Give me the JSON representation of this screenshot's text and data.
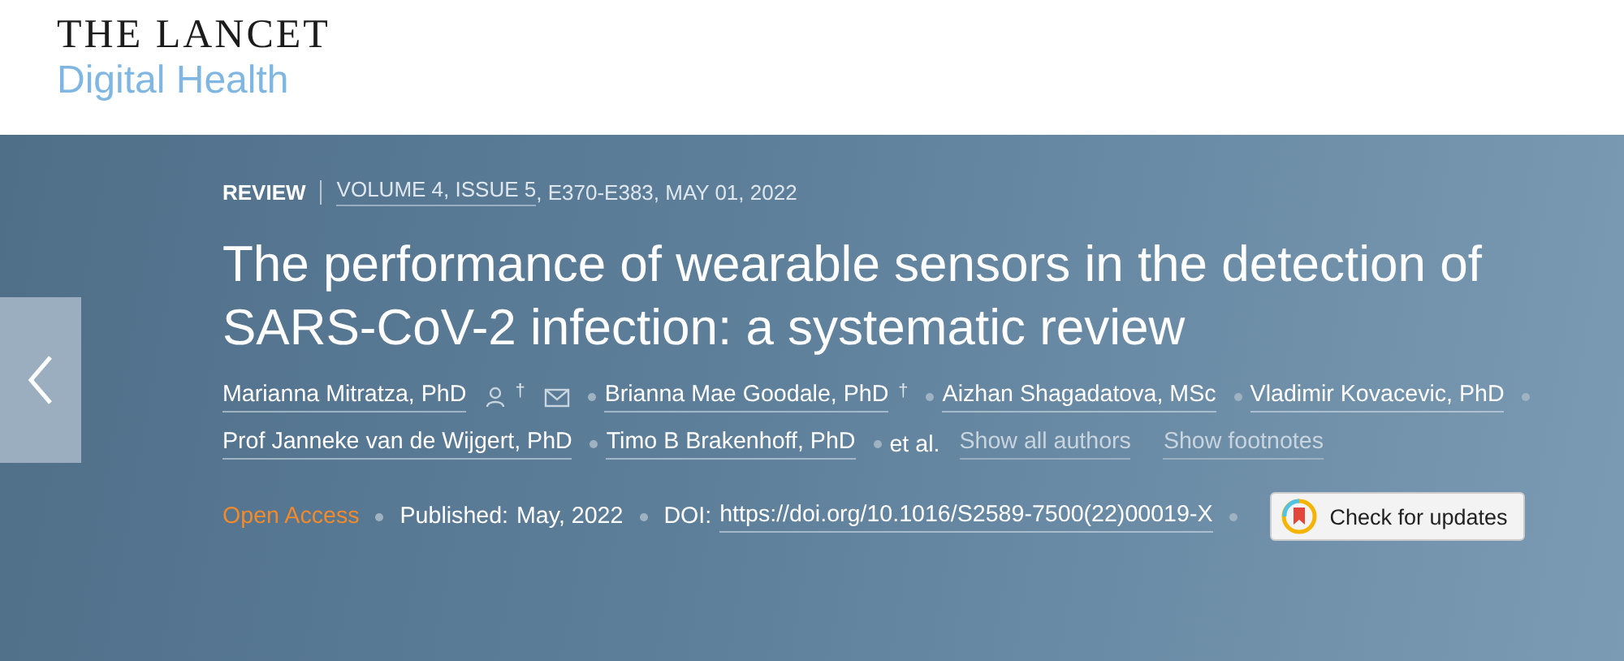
{
  "header": {
    "journal": "THE LANCET",
    "section": "Digital Health"
  },
  "article": {
    "type": "REVIEW",
    "issue_link": "VOLUME 4, ISSUE 5",
    "issue_rest": ", E370-E383, MAY 01, 2022",
    "title": "The performance of wearable sensors in the detection of SARS-CoV-2 infection: a systematic review",
    "authors": [
      {
        "name": "Marianna Mitratza, PhD",
        "contact": true,
        "footnote": "†"
      },
      {
        "name": "Brianna Mae Goodale, PhD",
        "contact": false,
        "footnote": "†"
      },
      {
        "name": "Aizhan Shagadatova, MSc",
        "contact": false
      },
      {
        "name": "Vladimir Kovacevic, PhD",
        "contact": false
      },
      {
        "name": "Prof Janneke van de Wijgert, PhD",
        "contact": false
      },
      {
        "name": "Timo B Brakenhoff, PhD",
        "contact": false
      }
    ],
    "et_al": "et al.",
    "show_authors": "Show all authors",
    "show_footnotes": "Show footnotes",
    "access": "Open Access",
    "published_label": "Published:",
    "published": "May, 2022",
    "doi_label": "DOI:",
    "doi": "https://doi.org/10.1016/S2589-7500(22)00019-X",
    "updates": "Check for updates"
  }
}
